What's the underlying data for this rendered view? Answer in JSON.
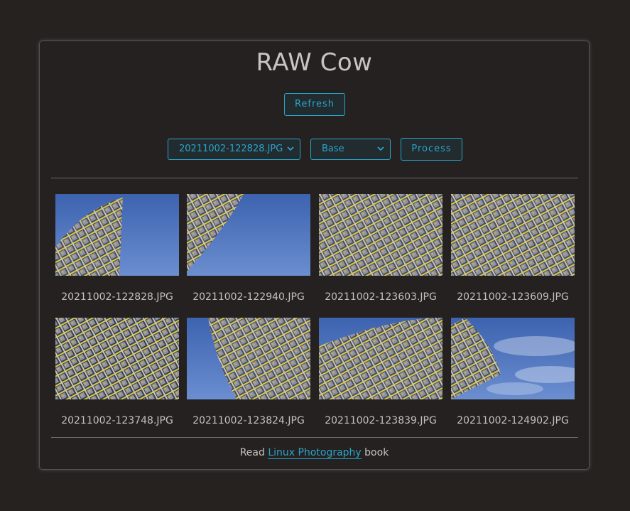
{
  "app": {
    "title": "RAW Cow"
  },
  "toolbar": {
    "refresh_label": "Refresh",
    "file_select_value": "20211002-122828.JPG",
    "preset_select_value": "Base",
    "process_label": "Process"
  },
  "gallery": {
    "items": [
      {
        "filename": "20211002-122828.JPG",
        "variant": "tower-left-sky"
      },
      {
        "filename": "20211002-122940.JPG",
        "variant": "curve-right-sky"
      },
      {
        "filename": "20211002-123603.JPG",
        "variant": "facade-full"
      },
      {
        "filename": "20211002-123609.JPG",
        "variant": "facade-full"
      },
      {
        "filename": "20211002-123748.JPG",
        "variant": "facade-full-dark"
      },
      {
        "filename": "20211002-123824.JPG",
        "variant": "tower-right-sky"
      },
      {
        "filename": "20211002-123839.JPG",
        "variant": "facade-top-sky"
      },
      {
        "filename": "20211002-124902.JPG",
        "variant": "tower-left-clouds"
      }
    ]
  },
  "footer": {
    "prefix": "Read",
    "link_text": "Linux Photography",
    "suffix": "book"
  },
  "colors": {
    "background": "#252220",
    "accent": "#2aa4cc",
    "text": "#c9c6c2",
    "divider": "#6b6e66"
  }
}
